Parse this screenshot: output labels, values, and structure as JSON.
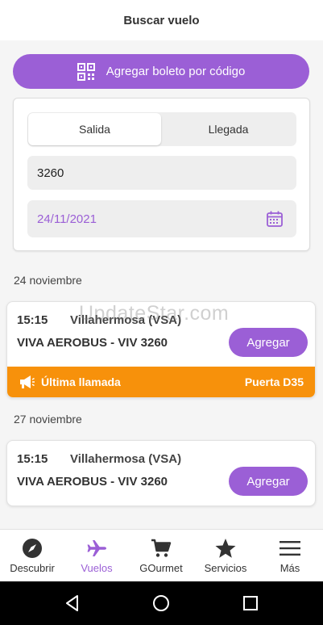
{
  "header": {
    "title": "Buscar vuelo"
  },
  "qr_button": {
    "label": "Agregar boleto por código",
    "icon": "qr-code-icon"
  },
  "search": {
    "tabs": [
      {
        "label": "Salida",
        "active": true
      },
      {
        "label": "Llegada",
        "active": false
      }
    ],
    "flight_number": "3260",
    "date": "24/11/2021",
    "date_icon": "calendar-icon"
  },
  "groups": [
    {
      "day": "24 noviembre",
      "flight": {
        "time": "15:15",
        "origin": "Villahermosa (VSA)",
        "airline": "VIVA AEROBUS - VIV 3260",
        "button": "Agregar",
        "alert": {
          "text": "Última llamada",
          "gate": "Puerta D35",
          "icon": "megaphone-icon"
        }
      }
    },
    {
      "day": "27 noviembre",
      "flight": {
        "time": "15:15",
        "origin": "Villahermosa (VSA)",
        "airline": "VIVA AEROBUS - VIV 3260",
        "button": "Agregar"
      }
    }
  ],
  "watermark": "UpdateStar.com",
  "tabbar": [
    {
      "label": "Descubrir",
      "icon": "compass-icon",
      "active": false
    },
    {
      "label": "Vuelos",
      "icon": "airplane-icon",
      "active": true
    },
    {
      "label": "GOurmet",
      "icon": "cart-icon",
      "active": false
    },
    {
      "label": "Servicios",
      "icon": "star-icon",
      "active": false
    },
    {
      "label": "Más",
      "icon": "menu-icon",
      "active": false
    }
  ],
  "colors": {
    "accent": "#9b5fd6",
    "alert": "#f7910b"
  }
}
